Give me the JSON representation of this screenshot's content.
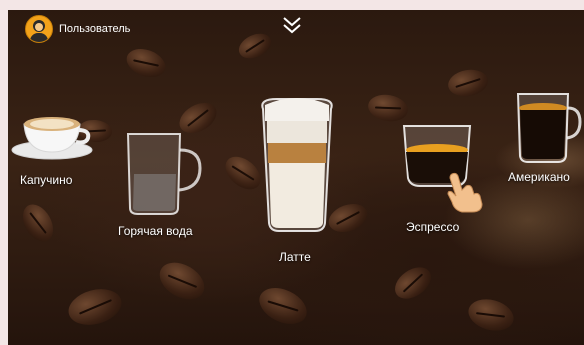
{
  "header": {
    "user_label": "Пользователь"
  },
  "drinks": [
    {
      "label": "Капучино"
    },
    {
      "label": "Горячая вода"
    },
    {
      "label": "Латте"
    },
    {
      "label": "Эспрессо"
    },
    {
      "label": "Американо"
    }
  ],
  "colors": {
    "avatar": "#f2a21a",
    "espresso_crema": "#e8a020",
    "background": "#2b190f"
  }
}
